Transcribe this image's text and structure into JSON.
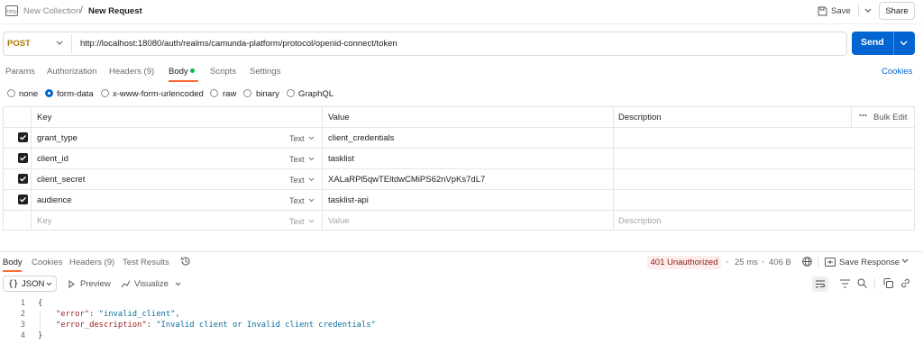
{
  "header": {
    "collection": "New Collection",
    "separator": "/",
    "request_name": "New Request",
    "save_label": "Save",
    "share_label": "Share"
  },
  "request": {
    "method": "POST",
    "url": "http://localhost:18080/auth/realms/camunda-platform/protocol/openid-connect/token",
    "send_label": "Send"
  },
  "tabs": [
    "Params",
    "Authorization",
    "Headers (9)",
    "Body",
    "Scripts",
    "Settings"
  ],
  "active_tab": "Body",
  "cookies_label": "Cookies",
  "body_modes": [
    "none",
    "form-data",
    "x-www-form-urlencoded",
    "raw",
    "binary",
    "GraphQL"
  ],
  "selected_body_mode": "form-data",
  "table": {
    "headers": {
      "key": "Key",
      "value": "Value",
      "description": "Description",
      "bulk_edit": "Bulk Edit"
    },
    "rows": [
      {
        "key": "grant_type",
        "type": "Text",
        "value": "client_credentials",
        "checked": true
      },
      {
        "key": "client_id",
        "type": "Text",
        "value": "tasklist",
        "checked": true
      },
      {
        "key": "client_secret",
        "type": "Text",
        "value": "XALaRPl5qwTEltdwCMiPS62nVpKs7dL7",
        "checked": true
      },
      {
        "key": "audience",
        "type": "Text",
        "value": "tasklist-api",
        "checked": true
      }
    ],
    "placeholder": {
      "key": "Key",
      "type": "Text",
      "value": "Value",
      "description": "Description"
    }
  },
  "response": {
    "tabs": [
      "Body",
      "Cookies",
      "Headers (9)",
      "Test Results"
    ],
    "status": "401 Unauthorized",
    "time": "25 ms",
    "size": "406 B",
    "save_response": "Save Response",
    "format": "JSON",
    "preview": "Preview",
    "visualize": "Visualize",
    "lines": [
      {
        "n": "1",
        "text": "{"
      },
      {
        "n": "2",
        "key": "\"error\"",
        "value": "\"invalid_client\","
      },
      {
        "n": "3",
        "key": "\"error_description\"",
        "value": "\"Invalid client or Invalid client credentials\""
      },
      {
        "n": "4",
        "text": "}"
      }
    ]
  },
  "colors": {
    "accent": "#ff6c37",
    "send": "#0265d2",
    "method": "#ad7a03",
    "status_bg": "#fdeeed",
    "status_fg": "#8e1a10"
  }
}
